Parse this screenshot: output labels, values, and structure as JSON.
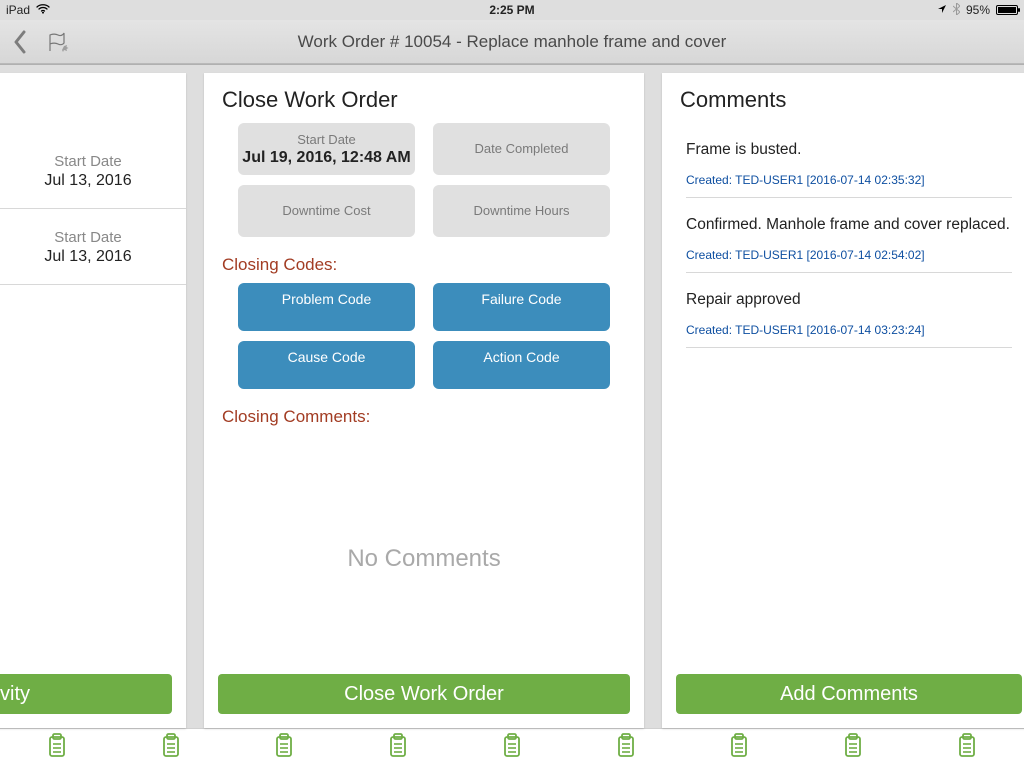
{
  "status": {
    "device": "iPad",
    "time": "2:25 PM",
    "battery_pct": "95%",
    "battery_fill_pct": 95
  },
  "nav": {
    "title": "Work Order # 10054 - Replace manhole frame and cover"
  },
  "left": {
    "items": [
      {
        "label": "Start Date",
        "value": "Jul 13, 2016"
      },
      {
        "label": "Start Date",
        "value": "Jul 13, 2016"
      }
    ],
    "button": "tivity"
  },
  "mid": {
    "heading": "Close Work Order",
    "fields": {
      "start_date": {
        "label": "Start Date",
        "value": "Jul 19, 2016, 12:48 AM"
      },
      "date_completed": {
        "label": "Date Completed",
        "value": ""
      },
      "downtime_cost": {
        "label": "Downtime Cost",
        "value": ""
      },
      "downtime_hours": {
        "label": "Downtime Hours",
        "value": ""
      }
    },
    "closing_codes_label": "Closing Codes:",
    "codes": {
      "problem": "Problem Code",
      "failure": "Failure Code",
      "cause": "Cause Code",
      "action": "Action Code"
    },
    "closing_comments_label": "Closing Comments:",
    "no_comments": "No Comments",
    "button": "Close Work Order"
  },
  "right": {
    "heading": "Comments",
    "comments": [
      {
        "text": "Frame is busted.",
        "meta": "Created: TED-USER1 [2016-07-14 02:35:32]"
      },
      {
        "text": "Confirmed.  Manhole frame and cover replaced.",
        "meta": "Created: TED-USER1 [2016-07-14 02:54:02]"
      },
      {
        "text": "Repair approved",
        "meta": "Created: TED-USER1 [2016-07-14 03:23:24]"
      }
    ],
    "button": "Add Comments"
  }
}
